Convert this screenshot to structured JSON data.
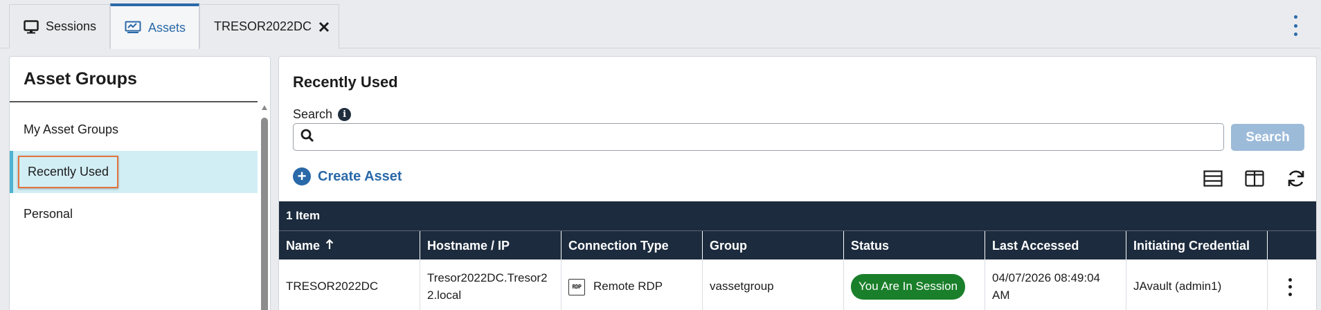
{
  "tabs": [
    {
      "label": "Sessions",
      "icon": "monitor-icon"
    },
    {
      "label": "Assets",
      "icon": "assets-icon"
    },
    {
      "label": "TRESOR2022DC",
      "icon": "close-icon"
    }
  ],
  "sidebar": {
    "title": "Asset Groups",
    "items": [
      {
        "label": "My Asset Groups"
      },
      {
        "label": "Recently Used",
        "selected": true
      },
      {
        "label": "Personal"
      }
    ]
  },
  "main": {
    "title": "Recently Used",
    "search_label": "Search",
    "search_placeholder": "",
    "search_button": "Search",
    "create_label": "Create Asset"
  },
  "table": {
    "count": "1 Item",
    "columns": [
      "Name",
      "Hostname / IP",
      "Connection Type",
      "Group",
      "Status",
      "Last Accessed",
      "Initiating Credential"
    ],
    "rows": [
      {
        "name": "TRESOR2022DC",
        "hostname": "Tresor2022DC.Tresor22.local",
        "connection_icon": "RDP",
        "connection": "Remote RDP",
        "group": "vassetgroup",
        "status": "You Are In Session",
        "last_accessed": "04/07/2026 08:49:04 AM",
        "credential": "JAvault (admin1)"
      }
    ]
  },
  "colors": {
    "accent": "#2a69a8",
    "header_bg": "#1c2b3d",
    "status_green": "#1a7f2a",
    "selected_bg": "#d2eef5",
    "highlight_border": "#e3743e"
  }
}
